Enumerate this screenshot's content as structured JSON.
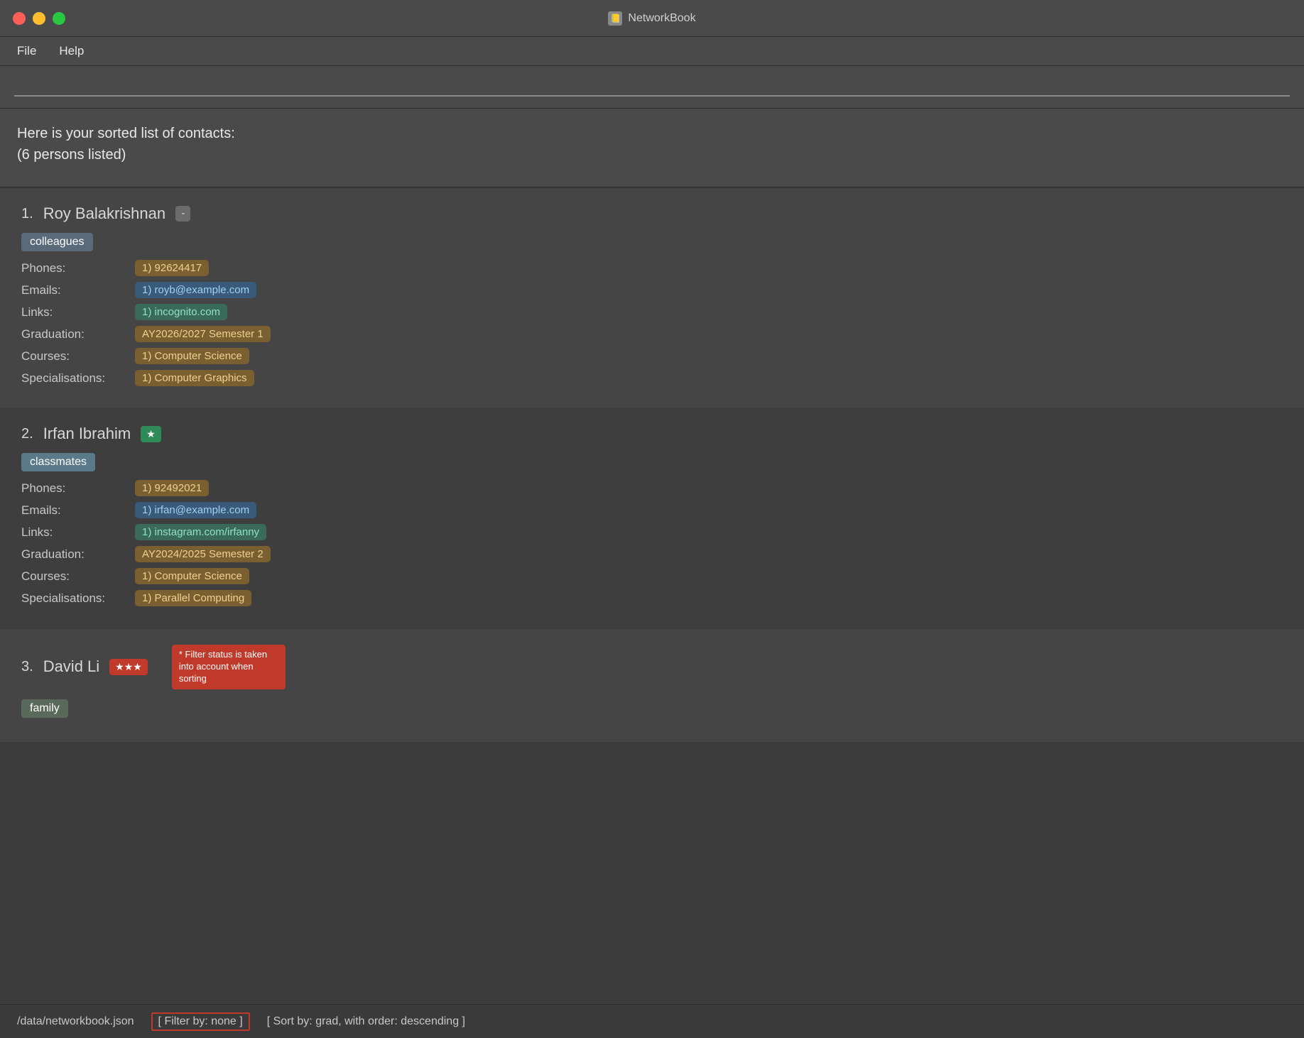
{
  "app": {
    "title": "NetworkBook",
    "icon": "📒"
  },
  "menu": {
    "file_label": "File",
    "help_label": "Help"
  },
  "search": {
    "placeholder": "",
    "value": ""
  },
  "status_banner": {
    "line1": "Here is your sorted list of contacts:",
    "line2": "(6 persons listed)"
  },
  "contacts": [
    {
      "number": "1.",
      "name": "Roy Balakrishnan",
      "badge": "-",
      "tag": "colleagues",
      "tag_type": "colleagues",
      "star_type": "none",
      "phones": [
        "1) 92624417"
      ],
      "emails": [
        "1) royb@example.com"
      ],
      "links": [
        "1) incognito.com"
      ],
      "graduation": "AY2026/2027 Semester 1",
      "courses": [
        "1) Computer Science"
      ],
      "specialisations": [
        "1) Computer Graphics"
      ]
    },
    {
      "number": "2.",
      "name": "Irfan Ibrahim",
      "badge": null,
      "tag": "classmates",
      "tag_type": "classmates",
      "star_type": "single",
      "phones": [
        "1) 92492021"
      ],
      "emails": [
        "1) irfan@example.com"
      ],
      "links": [
        "1) instagram.com/irfanny"
      ],
      "graduation": "AY2024/2025 Semester 2",
      "courses": [
        "1) Computer Science"
      ],
      "specialisations": [
        "1) Parallel Computing"
      ]
    },
    {
      "number": "3.",
      "name": "David Li",
      "badge": null,
      "tag": "family",
      "tag_type": "family",
      "star_type": "triple",
      "phones": [],
      "emails": [],
      "links": [],
      "graduation": null,
      "courses": [],
      "specialisations": []
    }
  ],
  "tooltip": "* Filter status is taken into account when sorting",
  "statusbar": {
    "path": "/data/networkbook.json",
    "filter": "[ Filter by: none ]",
    "sort": "[ Sort by: grad, with order: descending ]"
  }
}
